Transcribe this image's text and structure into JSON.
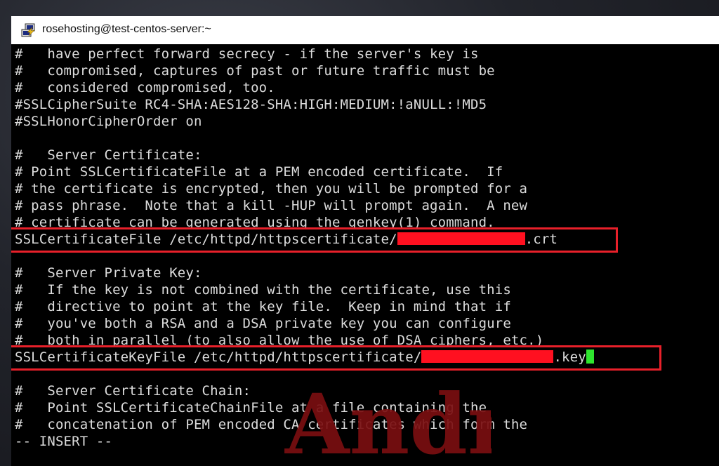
{
  "window": {
    "title": "rosehosting@test-centos-server:~",
    "icon": "putty-icon"
  },
  "terminal": {
    "lines": [
      "#   have perfect forward secrecy - if the server's key is",
      "#   compromised, captures of past or future traffic must be",
      "#   considered compromised, too.",
      "#SSLCipherSuite RC4-SHA:AES128-SHA:HIGH:MEDIUM:!aNULL:!MD5",
      "#SSLHonorCipherOrder on",
      "",
      "#   Server Certificate:",
      "# Point SSLCertificateFile at a PEM encoded certificate.  If",
      "# the certificate is encrypted, then you will be prompted for a",
      "# pass phrase.  Note that a kill -HUP will prompt again.  A new",
      "# certificate can be generated using the genkey(1) command."
    ],
    "cert_line_prefix": "SSLCertificateFile /etc/httpd/httpscertificate/",
    "cert_line_suffix": ".crt",
    "lines2": [
      "",
      "#   Server Private Key:",
      "#   If the key is not combined with the certificate, use this",
      "#   directive to point at the key file.  Keep in mind that if",
      "#   you've both a RSA and a DSA private key you can configure",
      "#   both in parallel (to also allow the use of DSA ciphers, etc.)"
    ],
    "key_line_prefix": "SSLCertificateKeyFile /etc/httpd/httpscertificate/",
    "key_line_suffix": ".key",
    "lines3": [
      "",
      "#   Server Certificate Chain:",
      "#   Point SSLCertificateChainFile at a file containing the",
      "#   concatenation of PEM encoded CA certificates which form the"
    ],
    "status_line": "-- INSERT --"
  },
  "colors": {
    "highlight_box": "#e8202a",
    "redaction": "#ff1020",
    "cursor": "#2ee52e",
    "watermark": "#7a0e10"
  },
  "watermark": {
    "text": "Andr"
  }
}
